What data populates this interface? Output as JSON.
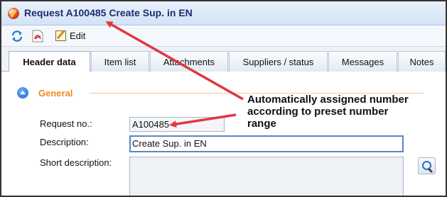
{
  "window": {
    "title": "Request A100485 Create Sup. in EN",
    "icon": "app-logo-icon"
  },
  "toolbar": {
    "refresh_icon": "refresh-icon",
    "pdf_icon": "pdf-icon",
    "edit_label": "Edit"
  },
  "tabs": [
    {
      "label": "Header data",
      "active": true
    },
    {
      "label": "Item list",
      "active": false
    },
    {
      "label": "Attachments",
      "active": false
    },
    {
      "label": "Suppliers / status",
      "active": false
    },
    {
      "label": "Messages",
      "active": false
    },
    {
      "label": "Notes",
      "active": false
    }
  ],
  "section": {
    "title": "General"
  },
  "fields": {
    "request_no_label": "Request no.:",
    "request_no_value": "A100485",
    "description_label": "Description:",
    "description_value": "Create Sup. in EN",
    "short_description_label": "Short description:",
    "short_description_value": ""
  },
  "annotation": {
    "text": "Automatically assigned number according to preset number range",
    "arrow_color": "#e0393e"
  },
  "colors": {
    "section_accent": "#f08a24",
    "title_text": "#1a2f6e"
  }
}
